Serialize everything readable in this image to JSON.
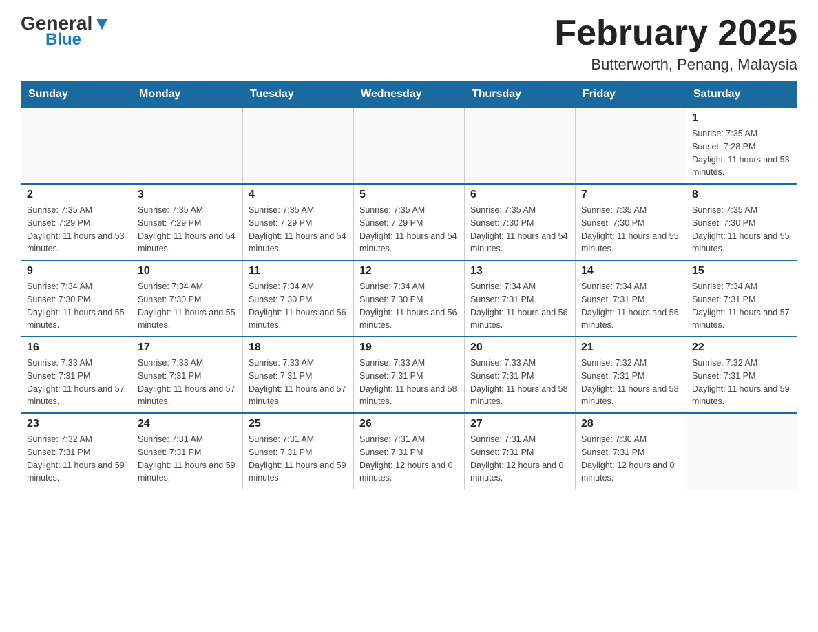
{
  "logo": {
    "general": "General",
    "triangle": "▼",
    "blue": "Blue"
  },
  "header": {
    "month": "February 2025",
    "location": "Butterworth, Penang, Malaysia"
  },
  "days_of_week": [
    "Sunday",
    "Monday",
    "Tuesday",
    "Wednesday",
    "Thursday",
    "Friday",
    "Saturday"
  ],
  "weeks": [
    [
      {
        "day": "",
        "sunrise": "",
        "sunset": "",
        "daylight": ""
      },
      {
        "day": "",
        "sunrise": "",
        "sunset": "",
        "daylight": ""
      },
      {
        "day": "",
        "sunrise": "",
        "sunset": "",
        "daylight": ""
      },
      {
        "day": "",
        "sunrise": "",
        "sunset": "",
        "daylight": ""
      },
      {
        "day": "",
        "sunrise": "",
        "sunset": "",
        "daylight": ""
      },
      {
        "day": "",
        "sunrise": "",
        "sunset": "",
        "daylight": ""
      },
      {
        "day": "1",
        "sunrise": "Sunrise: 7:35 AM",
        "sunset": "Sunset: 7:28 PM",
        "daylight": "Daylight: 11 hours and 53 minutes."
      }
    ],
    [
      {
        "day": "2",
        "sunrise": "Sunrise: 7:35 AM",
        "sunset": "Sunset: 7:29 PM",
        "daylight": "Daylight: 11 hours and 53 minutes."
      },
      {
        "day": "3",
        "sunrise": "Sunrise: 7:35 AM",
        "sunset": "Sunset: 7:29 PM",
        "daylight": "Daylight: 11 hours and 54 minutes."
      },
      {
        "day": "4",
        "sunrise": "Sunrise: 7:35 AM",
        "sunset": "Sunset: 7:29 PM",
        "daylight": "Daylight: 11 hours and 54 minutes."
      },
      {
        "day": "5",
        "sunrise": "Sunrise: 7:35 AM",
        "sunset": "Sunset: 7:29 PM",
        "daylight": "Daylight: 11 hours and 54 minutes."
      },
      {
        "day": "6",
        "sunrise": "Sunrise: 7:35 AM",
        "sunset": "Sunset: 7:30 PM",
        "daylight": "Daylight: 11 hours and 54 minutes."
      },
      {
        "day": "7",
        "sunrise": "Sunrise: 7:35 AM",
        "sunset": "Sunset: 7:30 PM",
        "daylight": "Daylight: 11 hours and 55 minutes."
      },
      {
        "day": "8",
        "sunrise": "Sunrise: 7:35 AM",
        "sunset": "Sunset: 7:30 PM",
        "daylight": "Daylight: 11 hours and 55 minutes."
      }
    ],
    [
      {
        "day": "9",
        "sunrise": "Sunrise: 7:34 AM",
        "sunset": "Sunset: 7:30 PM",
        "daylight": "Daylight: 11 hours and 55 minutes."
      },
      {
        "day": "10",
        "sunrise": "Sunrise: 7:34 AM",
        "sunset": "Sunset: 7:30 PM",
        "daylight": "Daylight: 11 hours and 55 minutes."
      },
      {
        "day": "11",
        "sunrise": "Sunrise: 7:34 AM",
        "sunset": "Sunset: 7:30 PM",
        "daylight": "Daylight: 11 hours and 56 minutes."
      },
      {
        "day": "12",
        "sunrise": "Sunrise: 7:34 AM",
        "sunset": "Sunset: 7:30 PM",
        "daylight": "Daylight: 11 hours and 56 minutes."
      },
      {
        "day": "13",
        "sunrise": "Sunrise: 7:34 AM",
        "sunset": "Sunset: 7:31 PM",
        "daylight": "Daylight: 11 hours and 56 minutes."
      },
      {
        "day": "14",
        "sunrise": "Sunrise: 7:34 AM",
        "sunset": "Sunset: 7:31 PM",
        "daylight": "Daylight: 11 hours and 56 minutes."
      },
      {
        "day": "15",
        "sunrise": "Sunrise: 7:34 AM",
        "sunset": "Sunset: 7:31 PM",
        "daylight": "Daylight: 11 hours and 57 minutes."
      }
    ],
    [
      {
        "day": "16",
        "sunrise": "Sunrise: 7:33 AM",
        "sunset": "Sunset: 7:31 PM",
        "daylight": "Daylight: 11 hours and 57 minutes."
      },
      {
        "day": "17",
        "sunrise": "Sunrise: 7:33 AM",
        "sunset": "Sunset: 7:31 PM",
        "daylight": "Daylight: 11 hours and 57 minutes."
      },
      {
        "day": "18",
        "sunrise": "Sunrise: 7:33 AM",
        "sunset": "Sunset: 7:31 PM",
        "daylight": "Daylight: 11 hours and 57 minutes."
      },
      {
        "day": "19",
        "sunrise": "Sunrise: 7:33 AM",
        "sunset": "Sunset: 7:31 PM",
        "daylight": "Daylight: 11 hours and 58 minutes."
      },
      {
        "day": "20",
        "sunrise": "Sunrise: 7:33 AM",
        "sunset": "Sunset: 7:31 PM",
        "daylight": "Daylight: 11 hours and 58 minutes."
      },
      {
        "day": "21",
        "sunrise": "Sunrise: 7:32 AM",
        "sunset": "Sunset: 7:31 PM",
        "daylight": "Daylight: 11 hours and 58 minutes."
      },
      {
        "day": "22",
        "sunrise": "Sunrise: 7:32 AM",
        "sunset": "Sunset: 7:31 PM",
        "daylight": "Daylight: 11 hours and 59 minutes."
      }
    ],
    [
      {
        "day": "23",
        "sunrise": "Sunrise: 7:32 AM",
        "sunset": "Sunset: 7:31 PM",
        "daylight": "Daylight: 11 hours and 59 minutes."
      },
      {
        "day": "24",
        "sunrise": "Sunrise: 7:31 AM",
        "sunset": "Sunset: 7:31 PM",
        "daylight": "Daylight: 11 hours and 59 minutes."
      },
      {
        "day": "25",
        "sunrise": "Sunrise: 7:31 AM",
        "sunset": "Sunset: 7:31 PM",
        "daylight": "Daylight: 11 hours and 59 minutes."
      },
      {
        "day": "26",
        "sunrise": "Sunrise: 7:31 AM",
        "sunset": "Sunset: 7:31 PM",
        "daylight": "Daylight: 12 hours and 0 minutes."
      },
      {
        "day": "27",
        "sunrise": "Sunrise: 7:31 AM",
        "sunset": "Sunset: 7:31 PM",
        "daylight": "Daylight: 12 hours and 0 minutes."
      },
      {
        "day": "28",
        "sunrise": "Sunrise: 7:30 AM",
        "sunset": "Sunset: 7:31 PM",
        "daylight": "Daylight: 12 hours and 0 minutes."
      },
      {
        "day": "",
        "sunrise": "",
        "sunset": "",
        "daylight": ""
      }
    ]
  ]
}
